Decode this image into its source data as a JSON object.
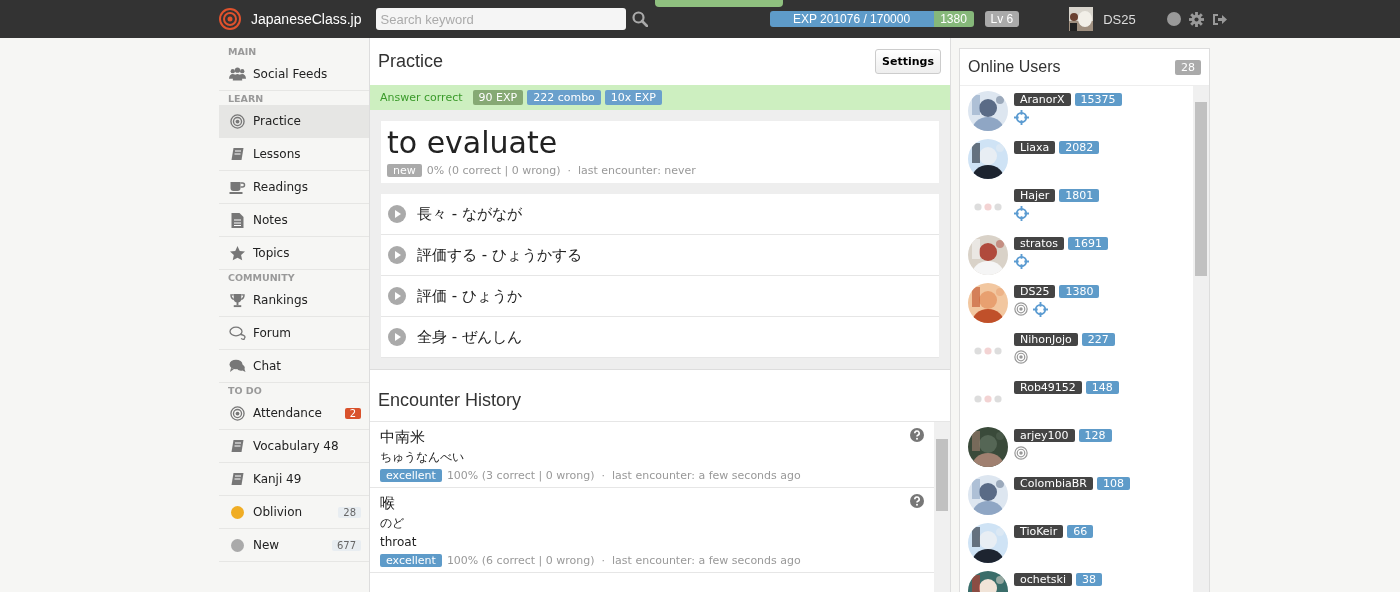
{
  "topbar": {
    "site_name": "JapaneseClass.jp",
    "search": {
      "placeholder": "Search keyword"
    },
    "exp": {
      "text": "EXP 201076 / 170000",
      "points": "1380"
    },
    "level": "Lv 6",
    "user": {
      "name": "DS25",
      "avatar": {
        "kind": "picture"
      }
    }
  },
  "sidebar": {
    "sections": [
      {
        "heading": "MAIN",
        "items": [
          {
            "kind": "people",
            "label": "Social Feeds",
            "selected": false
          }
        ]
      },
      {
        "heading": "LEARN",
        "items": [
          {
            "kind": "target",
            "label": "Practice",
            "selected": true
          },
          {
            "kind": "book",
            "label": "Lessons",
            "selected": false
          },
          {
            "kind": "cup",
            "label": "Readings",
            "selected": false
          },
          {
            "kind": "file",
            "label": "Notes",
            "selected": false
          },
          {
            "kind": "star",
            "label": "Topics",
            "selected": false
          }
        ]
      },
      {
        "heading": "COMMUNITY",
        "items": [
          {
            "kind": "trophy",
            "label": "Rankings",
            "selected": false
          },
          {
            "kind": "bubble",
            "label": "Forum",
            "selected": false
          },
          {
            "kind": "chat",
            "label": "Chat",
            "selected": false
          }
        ]
      },
      {
        "heading": "TO DO",
        "items": [
          {
            "kind": "target",
            "label": "Attendance",
            "selected": false,
            "count": "2",
            "alert": true
          },
          {
            "kind": "book",
            "label": "Vocabulary 48",
            "selected": false
          },
          {
            "kind": "book",
            "label": "Kanji 49",
            "selected": false
          },
          {
            "kind": "dot",
            "color": "#f0ad24",
            "label": "Oblivion",
            "selected": false,
            "count": "28",
            "alert": false
          },
          {
            "kind": "dot",
            "color": "#aaaaaa",
            "label": "New",
            "selected": false,
            "count": "677",
            "alert": false
          }
        ]
      }
    ]
  },
  "practice": {
    "title": "Practice",
    "settings_button": "Settings",
    "feedback": {
      "text": "Answer correct",
      "tags": [
        {
          "text": "90 EXP",
          "kind": "exp"
        },
        {
          "text": "222 combo",
          "kind": "info"
        },
        {
          "text": "10x EXP",
          "kind": "info"
        }
      ]
    },
    "word": {
      "text": "to evaluate",
      "status": "new",
      "stats": "0% (0 correct | 0 wrong)  ·  last encounter: never"
    },
    "choices": [
      "長々 - ながなが",
      "評価する - ひょうかする",
      "評価 - ひょうか",
      "全身 - ぜんしん"
    ]
  },
  "history": {
    "title": "Encounter History",
    "items": [
      {
        "kanji": "中南米",
        "reading": "ちゅうなんべい",
        "rating": "excellent",
        "stats": "100% (3 correct | 0 wrong)  ·  last encounter: a few seconds ago"
      },
      {
        "kanji": "喉",
        "reading": "のど",
        "meaning": "throat",
        "rating": "excellent",
        "stats": "100% (6 correct | 0 wrong)  ·  last encounter: a few seconds ago"
      }
    ]
  },
  "online_users": {
    "title": "Online Users",
    "count": "28",
    "users": [
      {
        "name": "AranorX",
        "score": "15375",
        "avatar": {
          "kind": "picture"
        },
        "badges": [
          {
            "kind": "crosshair"
          }
        ]
      },
      {
        "name": "Liaxa",
        "score": "2082",
        "avatar": {
          "kind": "picture"
        }
      },
      {
        "name": "Hajer",
        "score": "1801",
        "avatar": {
          "kind": "placeholder"
        },
        "badges": [
          {
            "kind": "crosshair"
          }
        ]
      },
      {
        "name": "stratos",
        "score": "1691",
        "avatar": {
          "kind": "picture"
        },
        "badges": [
          {
            "kind": "crosshair"
          }
        ]
      },
      {
        "name": "DS25",
        "score": "1380",
        "avatar": {
          "kind": "picture"
        },
        "badges": [
          {
            "kind": "target"
          },
          {
            "kind": "crosshair"
          }
        ]
      },
      {
        "name": "NihonJojo",
        "score": "227",
        "avatar": {
          "kind": "placeholder"
        },
        "badges": [
          {
            "kind": "target"
          }
        ]
      },
      {
        "name": "Rob49152",
        "score": "148",
        "avatar": {
          "kind": "placeholder"
        }
      },
      {
        "name": "arjey100",
        "score": "128",
        "avatar": {
          "kind": "picture"
        },
        "badges": [
          {
            "kind": "target"
          }
        ]
      },
      {
        "name": "ColombiaBR",
        "score": "108",
        "avatar": {
          "kind": "picture"
        }
      },
      {
        "name": "TioKeir",
        "score": "66",
        "avatar": {
          "kind": "picture"
        }
      },
      {
        "name": "ochetski",
        "score": "38",
        "avatar": {
          "kind": "picture"
        }
      }
    ]
  }
}
